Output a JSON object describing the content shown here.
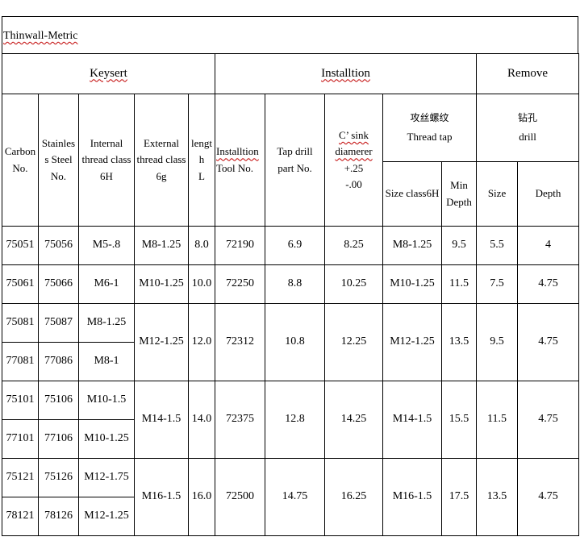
{
  "title": "Thinwall-Metric",
  "groups": {
    "keysert": "Keysert",
    "installation": "Installtion",
    "remove": "Remove"
  },
  "headers": {
    "carbon": [
      "Carbon",
      "No."
    ],
    "stainless": [
      "Stainles",
      "s Steel",
      "No."
    ],
    "internal": [
      "Internal",
      "thread class",
      "6H"
    ],
    "external": [
      "External",
      "thread class",
      "6g"
    ],
    "length": [
      "lengt",
      "h",
      "L"
    ],
    "tool": [
      "Installtion",
      "Tool No."
    ],
    "tap_drill": [
      "Tap drill",
      "part No."
    ],
    "csink": [
      "C’ sink",
      "diamerer",
      "+.25",
      "-.00"
    ],
    "thread_tap_cn": "攻丝螺纹",
    "thread_tap": "Thread tap",
    "drill_cn": "钻孔",
    "drill": "drill",
    "size_class": "Size class6H",
    "min_depth": [
      "Min",
      "Depth"
    ],
    "size": "Size",
    "depth": "Depth"
  },
  "rows": [
    {
      "carbon": "75051",
      "stainless": "75056",
      "internal": "M5-.8",
      "external": "M8-1.25",
      "length": "8.0",
      "tool": "72190",
      "tap_drill": "6.9",
      "csink": "8.25",
      "size_class": "M8-1.25",
      "min_depth": "9.5",
      "size": "5.5",
      "depth": "4"
    },
    {
      "carbon": "75061",
      "stainless": "75066",
      "internal": "M6-1",
      "external": "M10-1.25",
      "length": "10.0",
      "tool": "72250",
      "tap_drill": "8.8",
      "csink": "10.25",
      "size_class": "M10-1.25",
      "min_depth": "11.5",
      "size": "7.5",
      "depth": "4.75"
    },
    {
      "carbon": "75081",
      "stainless": "75087",
      "internal": "M8-1.25",
      "external": "M12-1.25",
      "length": "12.0",
      "tool": "72312",
      "tap_drill": "10.8",
      "csink": "12.25",
      "size_class": "M12-1.25",
      "min_depth": "13.5",
      "size": "9.5",
      "depth": "4.75"
    },
    {
      "carbon": "77081",
      "stainless": "77086",
      "internal": "M8-1"
    },
    {
      "carbon": "75101",
      "stainless": "75106",
      "internal": "M10-1.5",
      "external": "M14-1.5",
      "length": "14.0",
      "tool": "72375",
      "tap_drill": "12.8",
      "csink": "14.25",
      "size_class": "M14-1.5",
      "min_depth": "15.5",
      "size": "11.5",
      "depth": "4.75"
    },
    {
      "carbon": "77101",
      "stainless": "77106",
      "internal": "M10-1.25"
    },
    {
      "carbon": "75121",
      "stainless": "75126",
      "internal": "M12-1.75",
      "external": "M16-1.5",
      "length": "16.0",
      "tool": "72500",
      "tap_drill": "14.75",
      "csink": "16.25",
      "size_class": "M16-1.5",
      "min_depth": "17.5",
      "size": "13.5",
      "depth": "4.75"
    },
    {
      "carbon": "78121",
      "stainless": "78126",
      "internal": "M12-1.25"
    }
  ]
}
